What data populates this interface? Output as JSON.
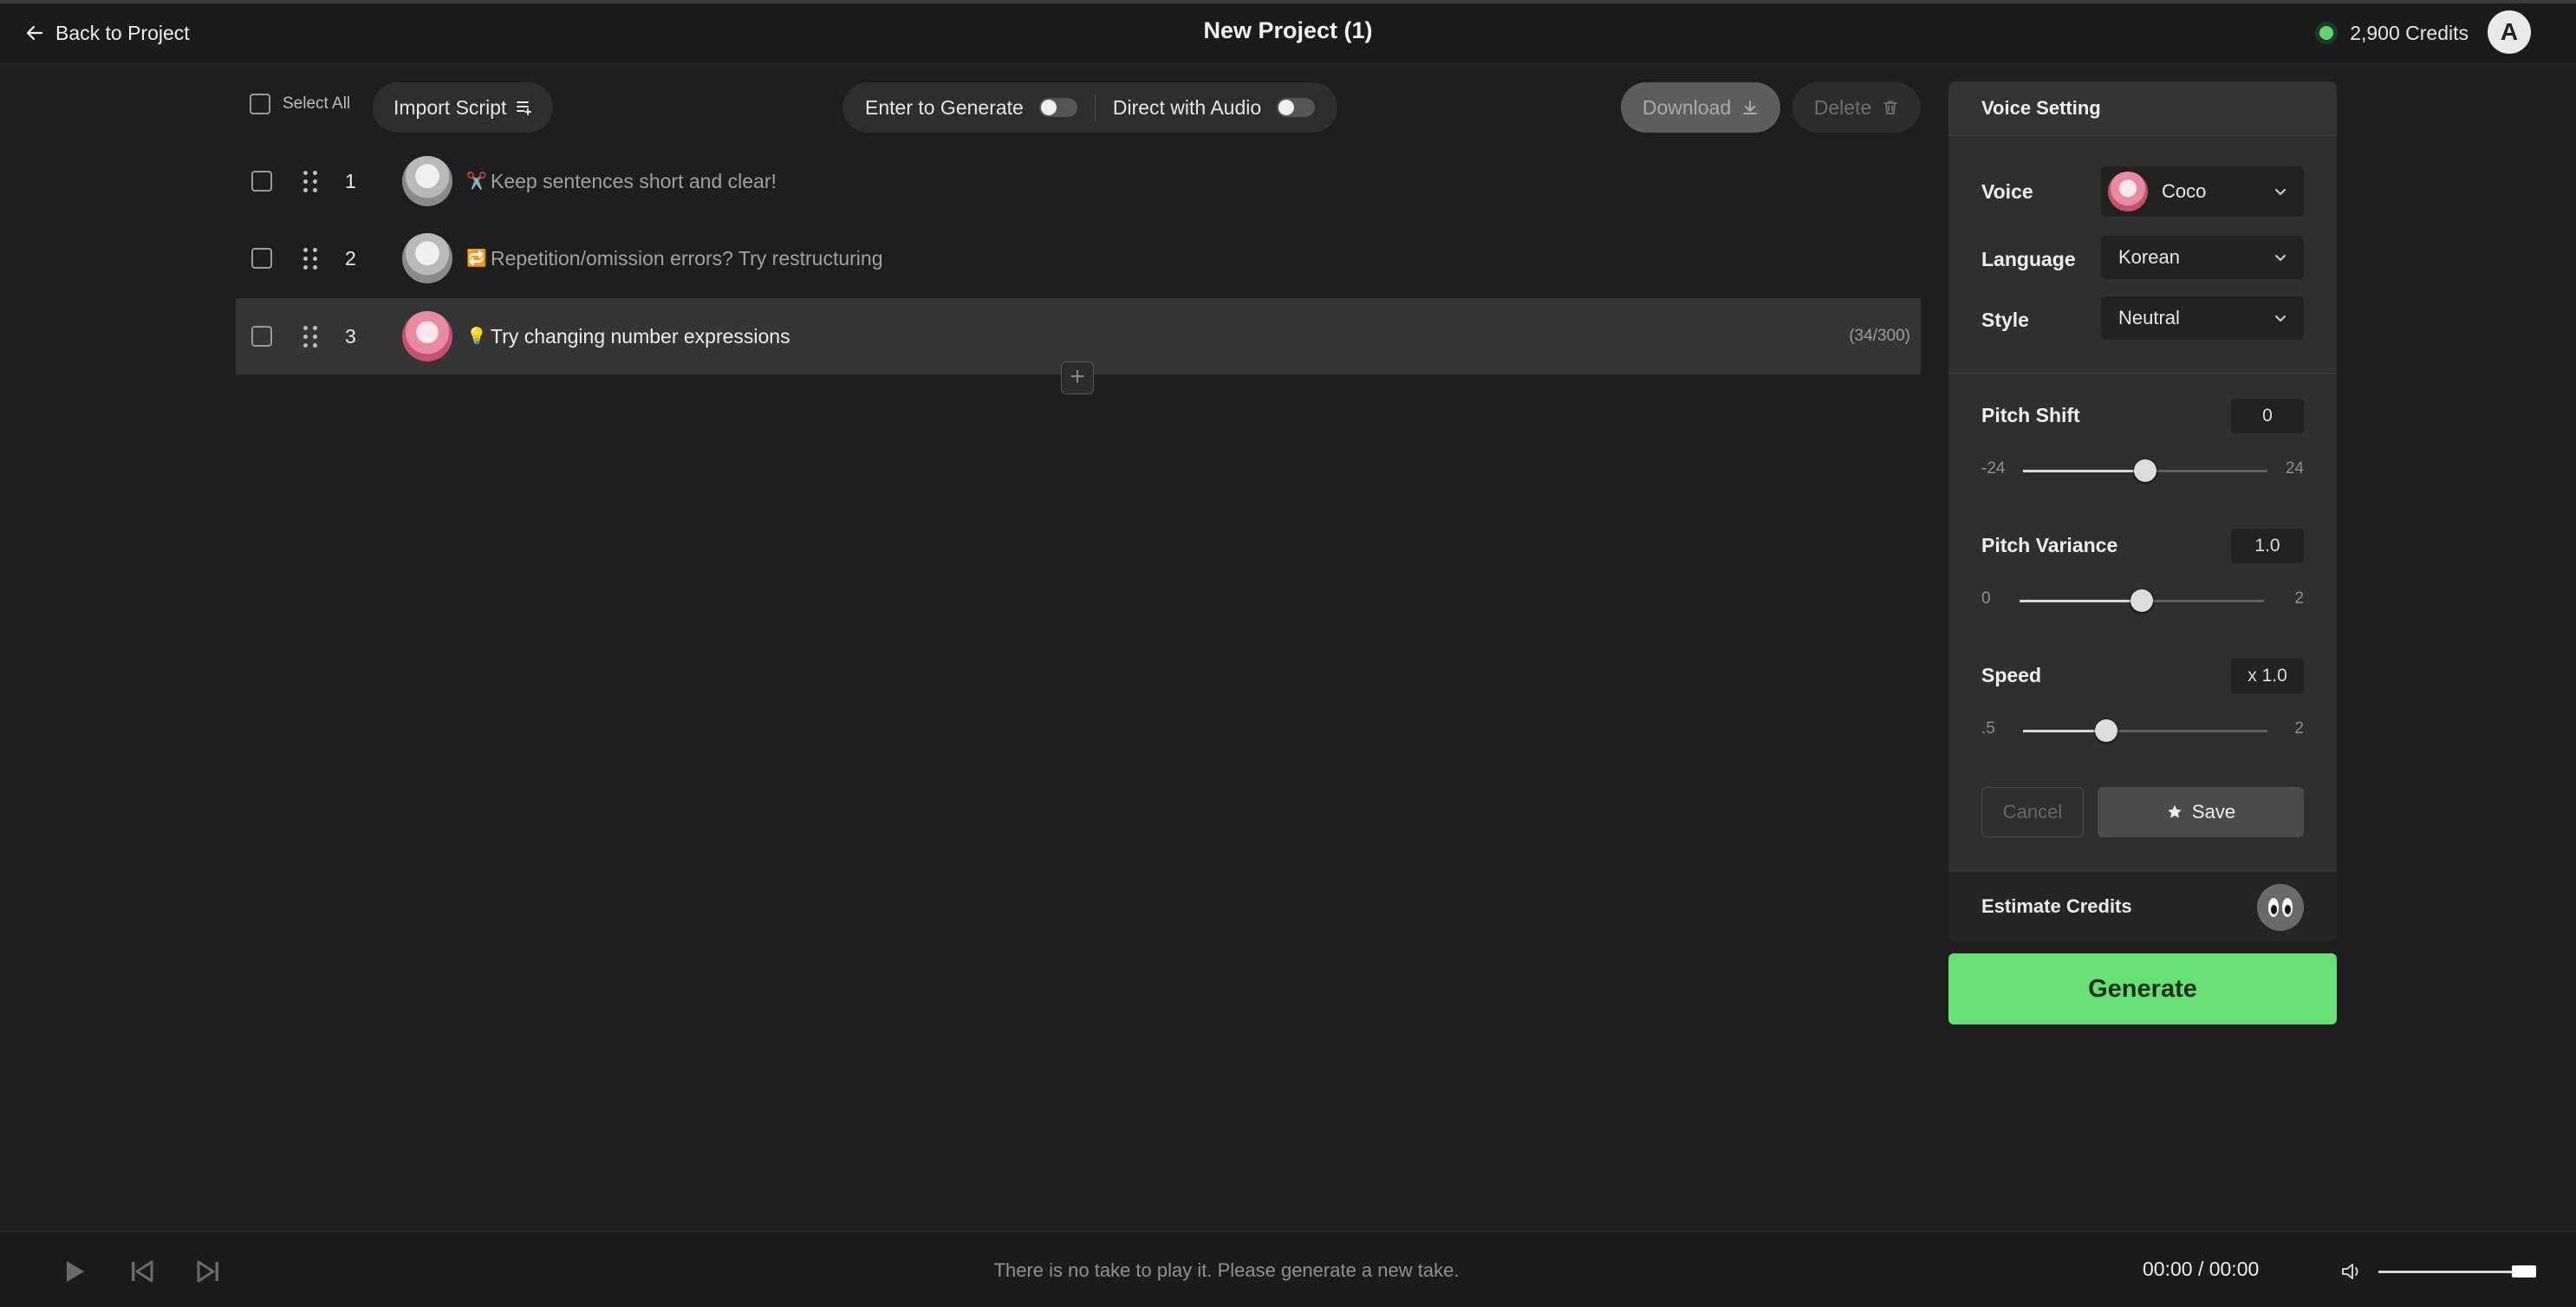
{
  "header": {
    "back_label": "Back to Project",
    "title": "New Project (1)",
    "credits_label": "2,900 Credits",
    "avatar_letter": "A",
    "status_color": "#5fd66d"
  },
  "toolbar": {
    "select_all_label": "Select All",
    "import_label": "Import Script",
    "enter_to_generate_label": "Enter to Generate",
    "enter_to_generate_on": false,
    "direct_audio_label": "Direct with Audio",
    "direct_audio_on": false,
    "download_label": "Download",
    "delete_label": "Delete"
  },
  "rows": [
    {
      "index": "1",
      "icon": "scissors-icon",
      "emoji": "✂️",
      "text": "Keep sentences short and clear!",
      "placeholder": true,
      "avatar": "gray-voice-avatar"
    },
    {
      "index": "2",
      "icon": "repeat-icon",
      "emoji": "🔁",
      "text": "Repetition/omission errors? Try restructuring",
      "placeholder": true,
      "avatar": "gray-voice-avatar"
    },
    {
      "index": "3",
      "icon": "bulb-icon",
      "emoji": "💡",
      "text": "Try changing number expressions",
      "placeholder": false,
      "avatar": "coco-avatar",
      "count": "(34/300)"
    }
  ],
  "voice_setting": {
    "title": "Voice Setting",
    "voice_label": "Voice",
    "voice_value": "Coco",
    "language_label": "Language",
    "language_value": "Korean",
    "style_label": "Style",
    "style_value": "Neutral",
    "pitch_shift": {
      "label": "Pitch Shift",
      "value": "0",
      "min": "-24",
      "max": "24",
      "fraction": 0.5
    },
    "pitch_variance": {
      "label": "Pitch Variance",
      "value": "1.0",
      "min": "0",
      "max": "2",
      "fraction": 0.5
    },
    "speed": {
      "label": "Speed",
      "value": "x 1.0",
      "min": ".5",
      "max": "2",
      "fraction": 0.34
    },
    "cancel_label": "Cancel",
    "save_label": "Save",
    "estimate_label": "Estimate Credits"
  },
  "generate_label": "Generate",
  "player": {
    "message": "There is no take to play it. Please generate a new take.",
    "time": "00:00 / 00:00",
    "volume_fraction": 0.95
  },
  "colors": {
    "accent": "#69e075",
    "background": "#1e1e1e",
    "panel": "#2f2f2f"
  }
}
